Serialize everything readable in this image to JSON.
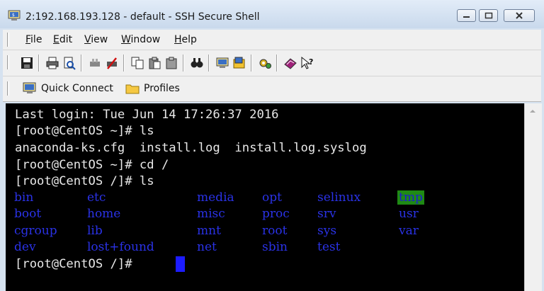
{
  "window": {
    "title": "2:192.168.193.128 - default - SSH Secure Shell"
  },
  "menu": {
    "items": [
      {
        "key": "F",
        "rest": "ile"
      },
      {
        "key": "E",
        "rest": "dit"
      },
      {
        "key": "V",
        "rest": "iew"
      },
      {
        "key": "W",
        "rest": "indow"
      },
      {
        "key": "H",
        "rest": "elp"
      }
    ]
  },
  "quickbar": {
    "quick_connect": "Quick Connect",
    "profiles": "Profiles"
  },
  "terminal": {
    "lines": [
      "Last login: Tue Jun 14 17:26:37 2016",
      "[root@CentOS ~]# ls",
      "anaconda-ks.cfg  install.log  install.log.syslog",
      "[root@CentOS ~]# cd /",
      "[root@CentOS /]# ls"
    ],
    "dirs": [
      [
        "bin",
        "etc",
        "media",
        "opt",
        "selinux",
        "tmp"
      ],
      [
        "boot",
        "home",
        "misc",
        "proc",
        "srv",
        "usr"
      ],
      [
        "cgroup",
        "lib",
        "mnt",
        "root",
        "sys",
        "var"
      ],
      [
        "dev",
        "lost+found",
        "net",
        "sbin",
        "test",
        ""
      ]
    ],
    "prompt": "[root@CentOS /]# ",
    "highlight_dir": "tmp",
    "colors": {
      "background": "#000000",
      "text": "#e8e8e8",
      "directory": "#2a32e6",
      "highlight_bg": "#1f8a14",
      "cursor": "#1c1cff"
    }
  }
}
